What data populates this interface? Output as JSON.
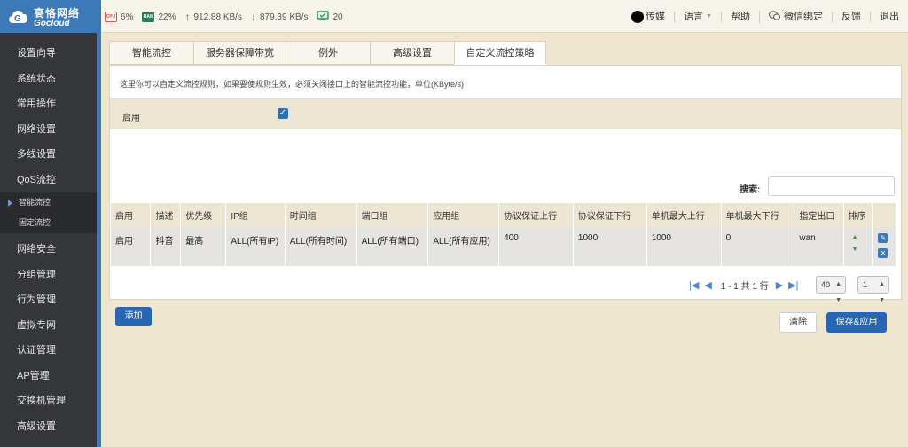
{
  "brand": {
    "name_cn": "高恪网络",
    "name_en": "Gocloud"
  },
  "stats": {
    "cpu_label": "CPU",
    "cpu": "6%",
    "ram_label": "RAM",
    "ram": "22%",
    "upload": "912.88 KB/s",
    "download": "879.39 KB/s",
    "connections": "20"
  },
  "topnav": {
    "user": "传媒",
    "language": "语言",
    "help": "帮助",
    "wechat": "微信绑定",
    "feedback": "反馈",
    "logout": "退出"
  },
  "sidebar": {
    "items": [
      "设置向导",
      "系统状态",
      "常用操作",
      "网络设置",
      "多线设置",
      "QoS流控"
    ],
    "sub": [
      "智能流控",
      "固定流控"
    ],
    "items2": [
      "网络安全",
      "分组管理",
      "行为管理",
      "虚拟专网",
      "认证管理",
      "AP管理",
      "交换机管理",
      "高级设置"
    ]
  },
  "tabs": [
    "智能流控",
    "服务器保障带宽",
    "例外",
    "高级设置",
    "自定义流控策略"
  ],
  "description": "这里你可以自定义流控规则，如果要使规则生效，必须关闭接口上的智能流控功能，单位(KByte/s)",
  "enable_label": "启用",
  "search_label": "搜索:",
  "table": {
    "headers": [
      "启用",
      "描述",
      "优先级",
      "IP组",
      "时间组",
      "端口组",
      "应用组",
      "协议保证上行",
      "协议保证下行",
      "单机最大上行",
      "单机最大下行",
      "指定出口",
      "排序",
      ""
    ],
    "rows": [
      [
        "启用",
        "抖音",
        "最高",
        "ALL(所有IP)",
        "ALL(所有时间)",
        "ALL(所有端口)",
        "ALL(所有应用)",
        "400",
        "1000",
        "1000",
        "0",
        "wan"
      ]
    ]
  },
  "pagination": {
    "summary": "1 - 1 共 1 行",
    "page_size": "40",
    "page": "1"
  },
  "buttons": {
    "add": "添加",
    "clear": "清除",
    "save": "保存&应用"
  },
  "colors": {
    "brand_blue": "#3d78b8",
    "button_blue": "#2866b1",
    "sidebar_bg": "#34363a",
    "page_bg": "#efe6cf"
  }
}
